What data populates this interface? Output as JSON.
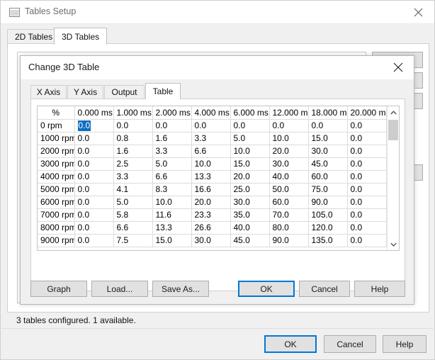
{
  "main_window": {
    "title": "Tables Setup",
    "icon": "window-icon",
    "close_icon": "close-icon",
    "tabs": [
      {
        "label": "2D Tables",
        "active": false
      },
      {
        "label": "3D Tables",
        "active": true
      }
    ],
    "side_buttons": [
      {
        "label": ""
      },
      {
        "label": ""
      },
      {
        "label": ""
      },
      {
        "label": ""
      }
    ],
    "status_text": "3 tables configured. 1 available.",
    "buttons": {
      "ok": "OK",
      "cancel": "Cancel",
      "help": "Help"
    }
  },
  "dialog": {
    "title": "Change 3D Table",
    "close_icon": "close-icon",
    "tabs": [
      {
        "label": "X Axis",
        "active": false
      },
      {
        "label": "Y Axis",
        "active": false
      },
      {
        "label": "Output",
        "active": false
      },
      {
        "label": "Table",
        "active": true
      }
    ],
    "buttons": {
      "graph": "Graph",
      "load": "Load...",
      "save_as": "Save As...",
      "ok": "OK",
      "cancel": "Cancel",
      "help": "Help"
    },
    "scrollbar": {
      "up_icon": "chevron-up-icon",
      "down_icon": "chevron-down-icon"
    }
  },
  "grid": {
    "corner_label": "%",
    "column_headers": [
      "0.000 ms",
      "1.000 ms",
      "2.000 ms",
      "4.000 ms",
      "6.000 ms",
      "12.000 m",
      "18.000 m",
      "20.000 m",
      ""
    ],
    "row_headers": [
      "0 rpm",
      "1000 rpm",
      "2000 rpm",
      "3000 rpm",
      "4000 rpm",
      "5000 rpm",
      "6000 rpm",
      "7000 rpm",
      "8000 rpm",
      "9000 rpm"
    ],
    "rows": [
      [
        "0.0",
        "0.0",
        "0.0",
        "0.0",
        "0.0",
        "0.0",
        "0.0",
        "0.0",
        ""
      ],
      [
        "0.0",
        "0.8",
        "1.6",
        "3.3",
        "5.0",
        "10.0",
        "15.0",
        "0.0",
        ""
      ],
      [
        "0.0",
        "1.6",
        "3.3",
        "6.6",
        "10.0",
        "20.0",
        "30.0",
        "0.0",
        ""
      ],
      [
        "0.0",
        "2.5",
        "5.0",
        "10.0",
        "15.0",
        "30.0",
        "45.0",
        "0.0",
        ""
      ],
      [
        "0.0",
        "3.3",
        "6.6",
        "13.3",
        "20.0",
        "40.0",
        "60.0",
        "0.0",
        ""
      ],
      [
        "0.0",
        "4.1",
        "8.3",
        "16.6",
        "25.0",
        "50.0",
        "75.0",
        "0.0",
        ""
      ],
      [
        "0.0",
        "5.0",
        "10.0",
        "20.0",
        "30.0",
        "60.0",
        "90.0",
        "0.0",
        ""
      ],
      [
        "0.0",
        "5.8",
        "11.6",
        "23.3",
        "35.0",
        "70.0",
        "105.0",
        "0.0",
        ""
      ],
      [
        "0.0",
        "6.6",
        "13.3",
        "26.6",
        "40.0",
        "80.0",
        "120.0",
        "0.0",
        ""
      ],
      [
        "0.0",
        "7.5",
        "15.0",
        "30.0",
        "45.0",
        "90.0",
        "135.0",
        "0.0",
        ""
      ]
    ],
    "selected_cell": {
      "row": 0,
      "col": 0,
      "value": "0.0"
    }
  },
  "colors": {
    "accent": "#0078d7",
    "selection": "#0d6fc0",
    "window_bg": "#f0f0f0",
    "button_bg": "#e1e1e1"
  }
}
